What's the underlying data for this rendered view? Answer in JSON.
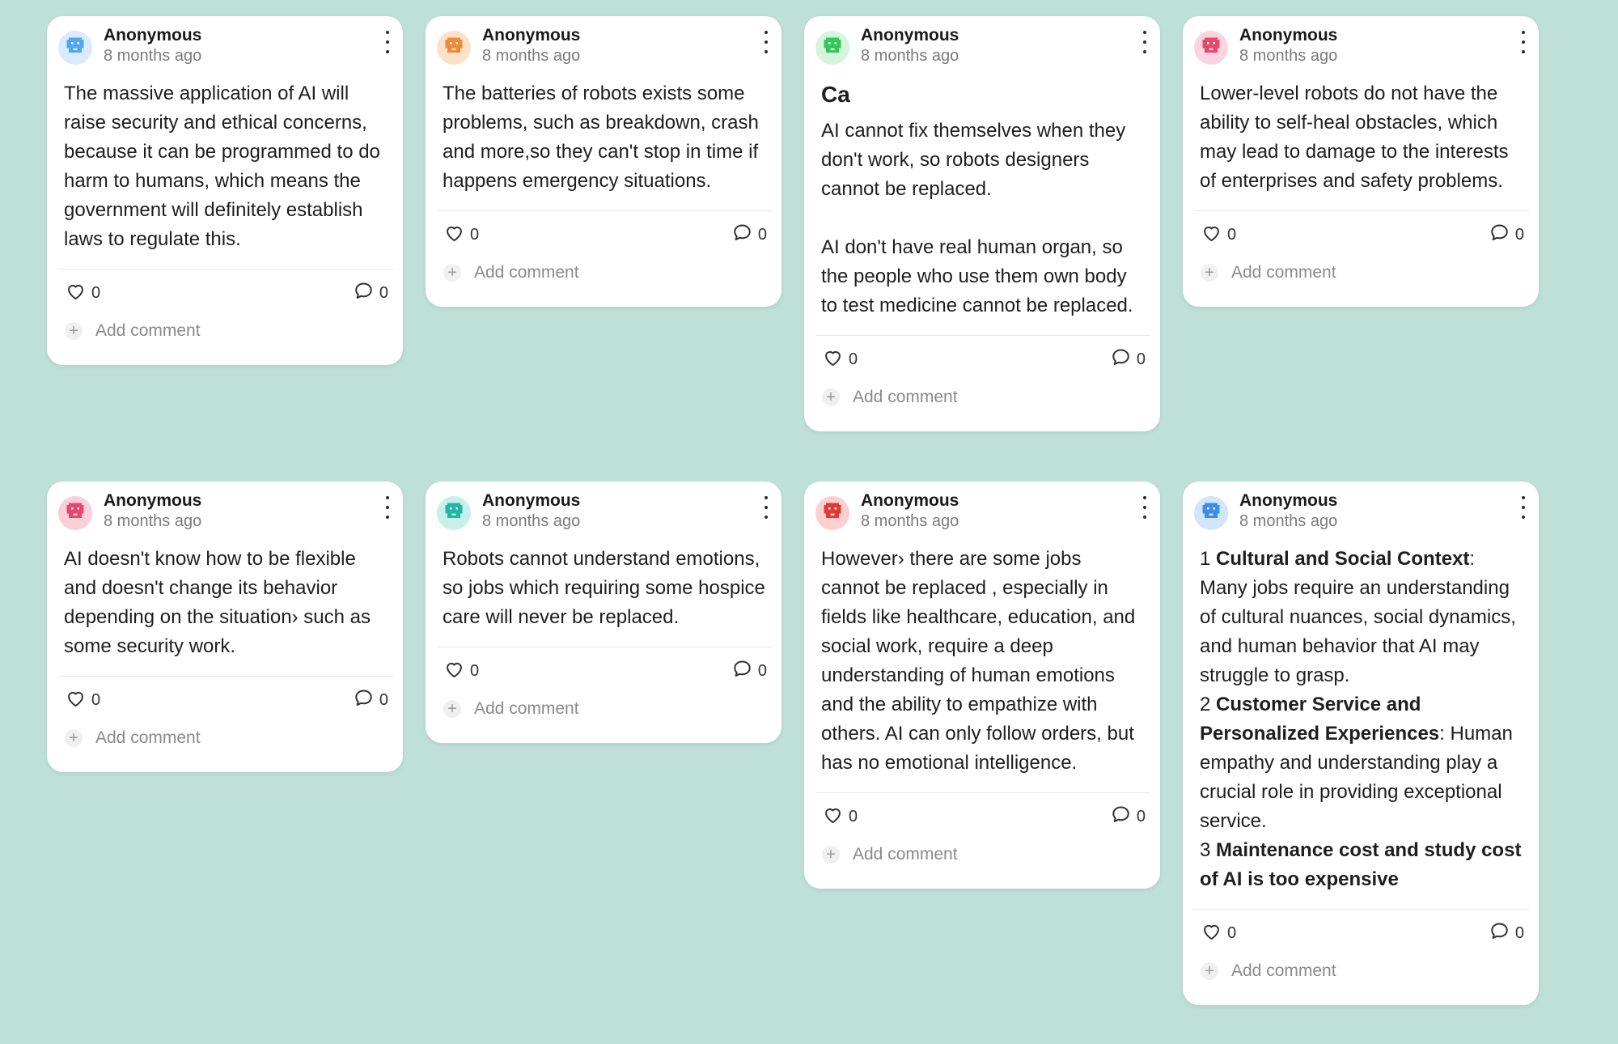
{
  "theme": {
    "background": "#bfe0d7",
    "card": "#ffffff"
  },
  "posts": [
    {
      "author": "Anonymous",
      "time": "8 months ago",
      "avatar_color": "#4fa8f0",
      "avatar_bg": "#d8ecfb",
      "avatar_icon": "robot-icon",
      "paragraphs": [
        "The massive application of AI will raise security and ethical concerns, because it can be programmed to do harm to humans, which means the government will definitely establish laws to regulate this."
      ],
      "likes": "0",
      "comments": "0",
      "add_comment": "Add comment"
    },
    {
      "author": "Anonymous",
      "time": "8 months ago",
      "avatar_color": "#f08a3a",
      "avatar_bg": "#fde2c8",
      "avatar_icon": "robot-icon",
      "paragraphs": [
        "The batteries of robots exists some problems, such as breakdown, crash and more,so they can't stop in time if happens emergency situations."
      ],
      "likes": "0",
      "comments": "0",
      "add_comment": "Add comment"
    },
    {
      "author": "Anonymous",
      "time": "8 months ago",
      "avatar_color": "#34c759",
      "avatar_bg": "#d6f5dc",
      "avatar_icon": "robot-icon",
      "title": "Ca",
      "paragraphs": [
        "AI cannot fix themselves when they don't work, so robots designers cannot be replaced.",
        "AI don't have real human organ, so the people who use them own body to test medicine cannot be replaced."
      ],
      "likes": "0",
      "comments": "0",
      "add_comment": "Add comment"
    },
    {
      "author": "Anonymous",
      "time": "8 months ago",
      "avatar_color": "#e8456f",
      "avatar_bg": "#fbd4df",
      "avatar_icon": "robot-icon",
      "paragraphs": [
        "Lower-level robots do not have the ability to self-heal obstacles, which may lead to damage to the interests of enterprises and safety problems."
      ],
      "likes": "0",
      "comments": "0",
      "add_comment": "Add comment"
    },
    {
      "author": "Anonymous",
      "time": "8 months ago",
      "avatar_color": "#e8456f",
      "avatar_bg": "#fbcfd8",
      "avatar_icon": "robot-icon",
      "paragraphs": [
        "AI doesn't know how to be flexible and doesn't change its behavior depending on the situation› such as some security work."
      ],
      "likes": "0",
      "comments": "0",
      "add_comment": "Add comment"
    },
    {
      "author": "Anonymous",
      "time": "8 months ago",
      "avatar_color": "#1fb8a6",
      "avatar_bg": "#c8f0ea",
      "avatar_icon": "robot-icon",
      "paragraphs": [
        "Robots cannot understand emotions, so jobs which requiring some hospice care will never be replaced."
      ],
      "likes": "0",
      "comments": "0",
      "add_comment": "Add comment"
    },
    {
      "author": "Anonymous",
      "time": "8 months ago",
      "avatar_color": "#e53935",
      "avatar_bg": "#fbd0cf",
      "avatar_icon": "robot-icon",
      "paragraphs": [
        "However› there are some jobs cannot be replaced , especially in fields like healthcare, education, and social work, require a deep understanding of human emotions and the ability to empathize with others. AI can only follow orders, but has no emotional intelligence."
      ],
      "likes": "0",
      "comments": "0",
      "add_comment": "Add comment"
    },
    {
      "author": "Anonymous",
      "time": "8 months ago",
      "avatar_color": "#3b8ee8",
      "avatar_bg": "#d2e6fb",
      "avatar_icon": "robot-icon",
      "rich": [
        {
          "num": "1 ",
          "bold": "Cultural and Social Context",
          "rest": ": Many jobs require an understanding of cultural nuances, social dynamics, and human behavior that AI may struggle to grasp."
        },
        {
          "num": "2 ",
          "bold": "Customer Service and Personalized Experiences",
          "rest": ": Human empathy and understanding play a crucial role in providing exceptional service."
        },
        {
          "num": "3 ",
          "bold": "Maintenance cost and study cost of AI is too expensive",
          "rest": ""
        }
      ],
      "likes": "0",
      "comments": "0",
      "add_comment": "Add comment"
    }
  ]
}
